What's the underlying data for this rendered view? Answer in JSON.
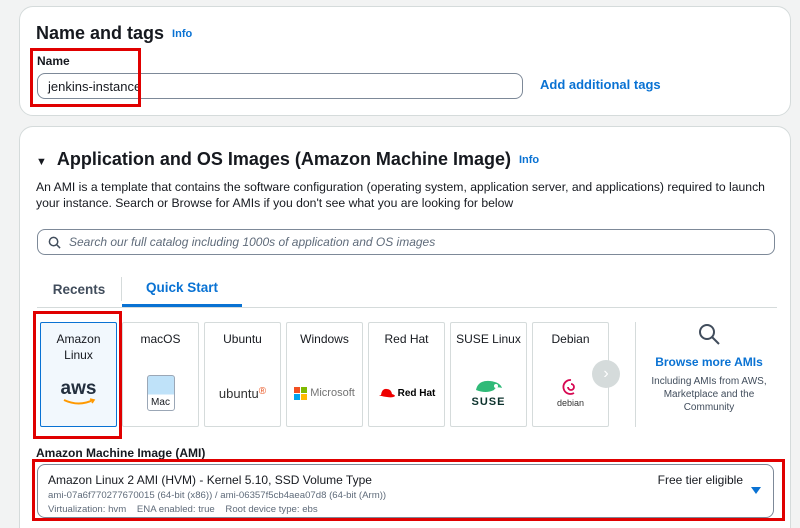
{
  "name_section": {
    "title": "Name and tags",
    "info": "Info",
    "field_label": "Name",
    "value": "jenkins-instance",
    "add_tags": "Add additional tags"
  },
  "ami_section": {
    "title": "Application and OS Images (Amazon Machine Image)",
    "info": "Info",
    "description": "An AMI is a template that contains the software configuration (operating system, application server, and applications) required to launch your instance. Search or Browse for AMIs if you don't see what you are looking for below",
    "search_placeholder": "Search our full catalog including 1000s of application and OS images",
    "tabs": [
      "Recents",
      "Quick Start"
    ],
    "active_tab": "Quick Start",
    "tiles": [
      {
        "name": "Amazon Linux",
        "logo": "aws",
        "selected": true
      },
      {
        "name": "macOS",
        "logo": "Mac"
      },
      {
        "name": "Ubuntu",
        "logo": "ubuntu"
      },
      {
        "name": "Windows",
        "logo": "Microsoft"
      },
      {
        "name": "Red Hat",
        "logo": "Red Hat"
      },
      {
        "name": "SUSE Linux",
        "logo": "SUSE"
      },
      {
        "name": "Debian",
        "logo": "debian"
      }
    ],
    "browse_more": "Browse more AMIs",
    "browse_sub": "Including AMIs from AWS, Marketplace and the Community",
    "ami_label": "Amazon Machine Image (AMI)",
    "ami_title": "Amazon Linux 2 AMI (HVM) - Kernel 5.10, SSD Volume Type",
    "ami_ids": "ami-07a6f770277670015 (64-bit (x86)) / ami-06357f5cb4aea07d8 (64-bit (Arm))",
    "ami_meta": "Virtualization: hvm    ENA enabled: true    Root device type: ebs",
    "free_tier": "Free tier eligible"
  },
  "colors": {
    "accent": "#0972d3",
    "highlight": "#e00000"
  }
}
